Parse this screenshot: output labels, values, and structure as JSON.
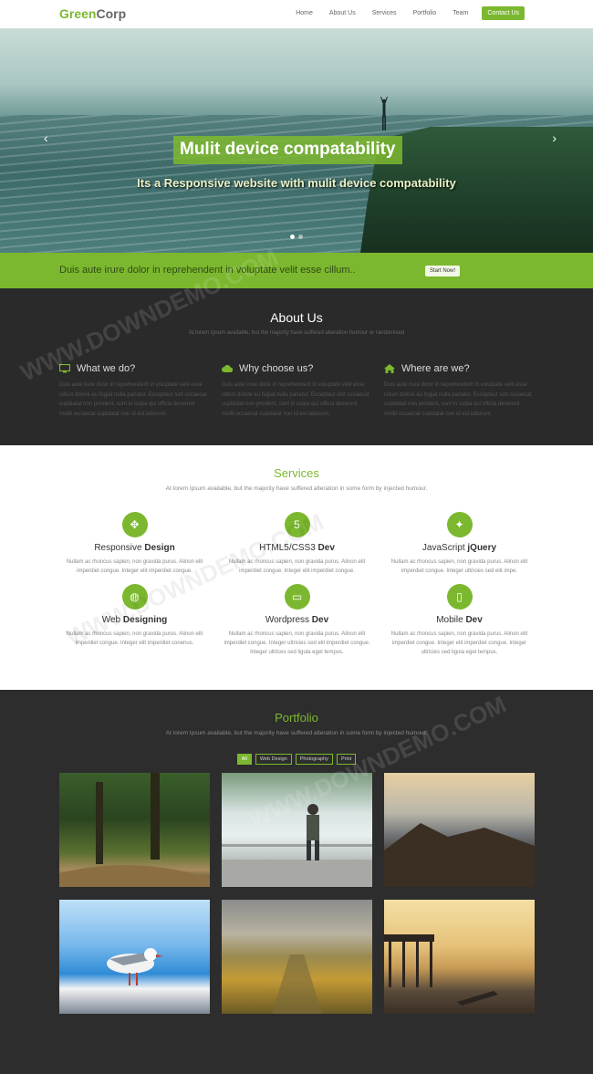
{
  "nav": {
    "logo_main": "Green",
    "logo_rest": "Corp",
    "items": [
      {
        "label": "Home"
      },
      {
        "label": "About Us"
      },
      {
        "label": "Services"
      },
      {
        "label": "Portfolio"
      },
      {
        "label": "Team"
      }
    ],
    "cta": "Contact Us"
  },
  "hero": {
    "title": "Mulit device compatability",
    "subtitle": "Its a Responsive website with mulit device compatability",
    "prev": "‹",
    "next": "›"
  },
  "banner": {
    "text": "Duis aute irure dolor in reprehendent in voluptate velit esse cillum..",
    "button": "Start Now!"
  },
  "about": {
    "title": "About Us",
    "subtitle": "At lorem Ipsum available, but the majority have suffered alteration humour or randomised",
    "columns": [
      {
        "title": "What we do?",
        "icon": "monitor-icon",
        "text": "Duis aute irure dolor in reprehenderit in voluptate velit esse cillum dolore eu fugiat nulla pariatur. Excepteur sint occaecat cupidatat non proident, sunt in culpa qui officia deserunt mollit occaecat cupidatat non id est laborum."
      },
      {
        "title": "Why choose us?",
        "icon": "cloud-icon",
        "text": "Duis aute irure dolor in reprehenderit in voluptate velit esse cillum dolore eu fugiat nulla pariatur. Excepteur sint occaecat cupidatat non proident, sunt in culpa qui officia deserunt mollit occaecat cupidatat non id est laborum."
      },
      {
        "title": "Where are we?",
        "icon": "home-icon",
        "text": "Duis aute irure dolor in reprehenderit in voluptate velit esse cillum dolore eu fugiat nulla pariatur. Excepteur sint occaecat cupidatat non proident, sunt in culpa qui officia deserunt mollit occaecat cupidatat non id est laborum."
      }
    ]
  },
  "services": {
    "title": "Services",
    "subtitle": "At lorem Ipsum available, but the majority have suffered alteration in some form by injected humour.",
    "items": [
      {
        "name_a": "Responsive ",
        "name_b": "Design",
        "icon": "move-icon",
        "glyph": "✥",
        "text": "Nullam ac rhoncus sapien, non gravida purus. Alinon elit imperdiet congue. Integer elit imperdiet congue."
      },
      {
        "name_a": "HTML5/CSS3 ",
        "name_b": "Dev",
        "icon": "html5-icon",
        "glyph": "5",
        "text": "Nullam ac rhoncus sapien, non gravida purus. Alinon elit imperdiet congue. Integer elit imperdiet congue."
      },
      {
        "name_a": "JavaScript ",
        "name_b": "jQuery",
        "icon": "lightbulb-icon",
        "glyph": "✦",
        "text": "Nullam ac rhoncus sapien, non gravida purus. Alinon elit imperdiet congue. Integer ultricies sed elit impe."
      },
      {
        "name_a": "Web ",
        "name_b": "Designing",
        "icon": "globe-icon",
        "glyph": "◍",
        "text": "Nullam ac rhoncus sapien, non gravida purus. Alinon elit imperdiet congue. Integer elit imperdiet conenus."
      },
      {
        "name_a": "Wordpress ",
        "name_b": "Dev",
        "icon": "desktop-icon",
        "glyph": "▭",
        "text": "Nullam ac rhoncus sapien, non gravida purus. Alinon elit imperdiet congue. Integer ultricies sed elit imperdiet congue. Integer ultrices sed ligula eget tempus."
      },
      {
        "name_a": "Mobile ",
        "name_b": "Dev",
        "icon": "mobile-icon",
        "glyph": "▯",
        "text": "Nullam ac rhoncus sapien, non gravida purus. Alinon elit imperdiet congue. Integer elit imperdiet congue. Integer ultricies sed ligula eget tempus."
      }
    ]
  },
  "portfolio": {
    "title": "Portfolio",
    "subtitle": "At lorem Ipsum available, but the majority have suffered alteration in some form by injected humour.",
    "filters": [
      {
        "label": "All",
        "active": true
      },
      {
        "label": "Web Design",
        "active": false
      },
      {
        "label": "Photography",
        "active": false
      },
      {
        "label": "Print",
        "active": false
      }
    ]
  },
  "watermark": "WWW.DOWNDEMO.COM",
  "colors": {
    "accent": "#7cb82f",
    "dark": "#2a2a2a"
  }
}
